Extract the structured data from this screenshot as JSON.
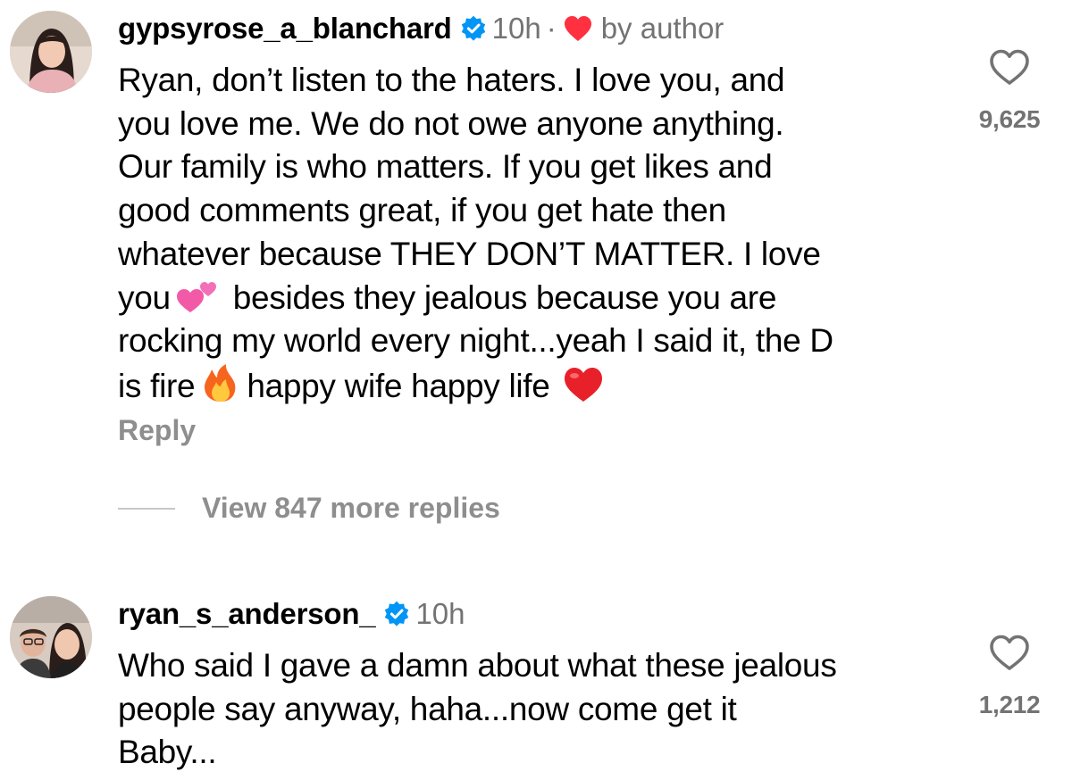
{
  "comments": [
    {
      "username": "gypsyrose_a_blanchard",
      "time": "10h",
      "separator": "·",
      "by_author": "by author",
      "text_lines": [
        "Ryan, don’t listen to the haters. I love you, and",
        "you love me. We do not owe anyone anything.",
        "Our family is who matters. If you get likes and",
        "good comments great, if you get hate then",
        "whatever because THEY DON’T MATTER. I love",
        "you",
        "besides they jealous because you are",
        "rocking my world every night...yeah I said it, the D",
        "is fire",
        "happy wife happy life"
      ],
      "reply_label": "Reply",
      "view_replies": "View 847 more replies",
      "likes": "9,625"
    },
    {
      "username": "ryan_s_anderson_",
      "time": "10h",
      "text_lines": [
        "Who said I gave a damn about what these jealous",
        "people say anyway, haha...now come get it",
        "Baby..."
      ],
      "likes": "1,212"
    }
  ],
  "colors": {
    "verified_blue": "#0095f6",
    "author_heart_red": "#ff3040",
    "secondary_text": "#737373"
  },
  "icons": {
    "verified": "verified-badge-icon",
    "like": "heart-outline-icon",
    "author_like": "red-heart-icon",
    "emoji_hearts": "two-hearts-emoji",
    "emoji_fire": "fire-emoji",
    "emoji_red_heart": "red-heart-emoji"
  }
}
